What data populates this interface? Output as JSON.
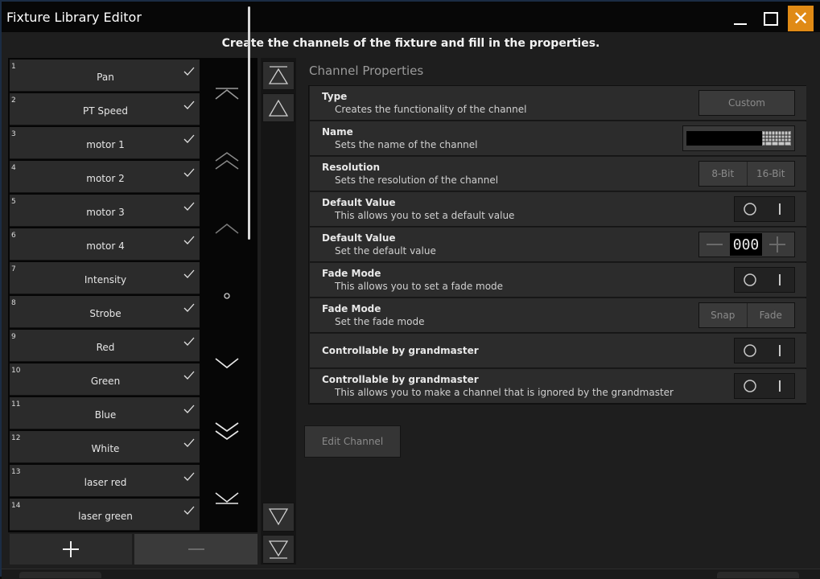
{
  "window": {
    "title": "Fixture Library Editor"
  },
  "instruction": "Create the channels of the fixture and fill in the properties.",
  "channels": [
    {
      "num": "1",
      "label": "Pan"
    },
    {
      "num": "2",
      "label": "PT Speed"
    },
    {
      "num": "3",
      "label": "motor 1"
    },
    {
      "num": "4",
      "label": "motor 2"
    },
    {
      "num": "5",
      "label": "motor 3"
    },
    {
      "num": "6",
      "label": "motor 4"
    },
    {
      "num": "7",
      "label": "Intensity"
    },
    {
      "num": "8",
      "label": "Strobe"
    },
    {
      "num": "9",
      "label": "Red"
    },
    {
      "num": "10",
      "label": "Green"
    },
    {
      "num": "11",
      "label": "Blue"
    },
    {
      "num": "12",
      "label": "White"
    },
    {
      "num": "13",
      "label": "laser red"
    },
    {
      "num": "14",
      "label": "laser green"
    }
  ],
  "properties": {
    "title": "Channel Properties",
    "type": {
      "title": "Type",
      "desc": "Creates the functionality of the channel",
      "button": "Custom"
    },
    "name": {
      "title": "Name",
      "desc": "Sets the name of the channel",
      "value": ""
    },
    "resolution": {
      "title": "Resolution",
      "desc": "Sets the resolution of the channel",
      "opt1": "8-Bit",
      "opt2": "16-Bit"
    },
    "default_toggle": {
      "title": "Default Value",
      "desc": "This allows you to set a default value"
    },
    "default_value": {
      "title": "Default Value",
      "desc": "Set the default value",
      "value": "000"
    },
    "fade_toggle": {
      "title": "Fade Mode",
      "desc": "This allows you to set a fade mode"
    },
    "fade_mode": {
      "title": "Fade Mode",
      "desc": "Set the fade mode",
      "opt1": "Snap",
      "opt2": "Fade"
    },
    "gm_toggle": {
      "title": "Controllable by grandmaster"
    },
    "gm_toggle2": {
      "title": "Controllable by grandmaster",
      "desc": "This allows you to make a channel that is ignored by the grandmaster"
    }
  },
  "edit_channel_label": "Edit Channel",
  "colors": {
    "close": "#e08a15",
    "row": "#2b2b2b",
    "panel": "#1e1e1e"
  }
}
